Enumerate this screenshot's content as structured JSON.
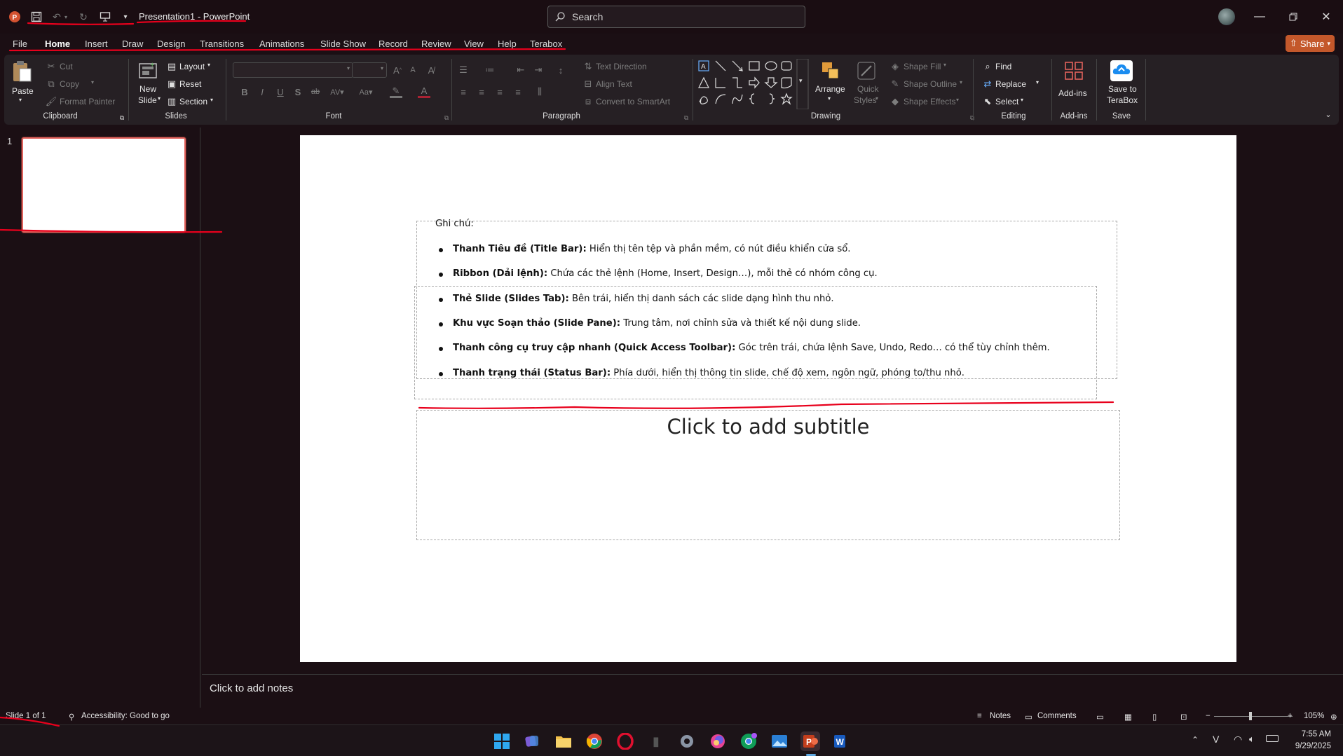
{
  "app": {
    "title": "Presentation1 - PowerPoint"
  },
  "search": {
    "placeholder": "Search"
  },
  "tabs": [
    "File",
    "Home",
    "Insert",
    "Draw",
    "Design",
    "Transitions",
    "Animations",
    "Slide Show",
    "Record",
    "Review",
    "View",
    "Help",
    "Terabox"
  ],
  "share_label": "Share",
  "ribbon": {
    "clipboard": {
      "paste": "Paste",
      "cut": "Cut",
      "copy": "Copy",
      "format_painter": "Format Painter",
      "label": "Clipboard"
    },
    "slides": {
      "new_slide": "New",
      "new_slide2": "Slide",
      "layout": "Layout",
      "reset": "Reset",
      "section": "Section",
      "label": "Slides"
    },
    "font": {
      "label": "Font"
    },
    "paragraph": {
      "text_direction": "Text Direction",
      "align_text": "Align Text",
      "smartart": "Convert to SmartArt",
      "label": "Paragraph"
    },
    "drawing": {
      "arrange": "Arrange",
      "quick_styles": "Quick",
      "quick_styles2": "Styles",
      "shape_fill": "Shape Fill",
      "shape_outline": "Shape Outline",
      "shape_effects": "Shape Effects",
      "label": "Drawing"
    },
    "editing": {
      "find": "Find",
      "replace": "Replace",
      "select": "Select",
      "label": "Editing"
    },
    "addins": {
      "addins": "Add-ins",
      "label": "Add-ins"
    },
    "save": {
      "save_to": "Save to",
      "terabox": "TeraBox",
      "label": "Save"
    }
  },
  "thumbnails": [
    {
      "number": "1"
    }
  ],
  "slide": {
    "note_heading": "Ghi chú:",
    "bullets": [
      {
        "bold": "Thanh Tiêu đề (Title Bar):",
        "text": " Hiển thị tên tệp và phần mềm, có nút điều khiển cửa sổ."
      },
      {
        "bold": "Ribbon (Dải lệnh):",
        "text": " Chứa các thẻ lệnh (Home, Insert, Design…), mỗi thẻ có nhóm công cụ."
      },
      {
        "bold": "Thẻ Slide (Slides Tab):",
        "text": " Bên trái, hiển thị danh sách các slide dạng hình thu nhỏ."
      },
      {
        "bold": "Khu vực Soạn thảo (Slide Pane):",
        "text": " Trung tâm, nơi chỉnh sửa và thiết kế nội dung slide."
      },
      {
        "bold": "Thanh công cụ truy cập nhanh (Quick Access Toolbar):",
        "text": " Góc trên trái, chứa lệnh Save, Undo, Redo… có thể tùy chỉnh thêm."
      },
      {
        "bold": "Thanh trạng thái (Status Bar):",
        "text": " Phía dưới, hiển thị thông tin slide, chế độ xem, ngôn ngữ, phóng to/thu nhỏ."
      }
    ],
    "subtitle_placeholder": "Click to add subtitle"
  },
  "notes": {
    "placeholder": "Click to add notes"
  },
  "status": {
    "slide": "Slide 1 of 1",
    "accessibility": "Accessibility: Good to go",
    "notes": "Notes",
    "comments": "Comments",
    "zoom": "105%"
  },
  "taskbar": {
    "time": "7:55 AM",
    "date": "9/29/2025"
  },
  "colors": {
    "accent": "#c4582b",
    "annotation_red": "#e8001c"
  }
}
